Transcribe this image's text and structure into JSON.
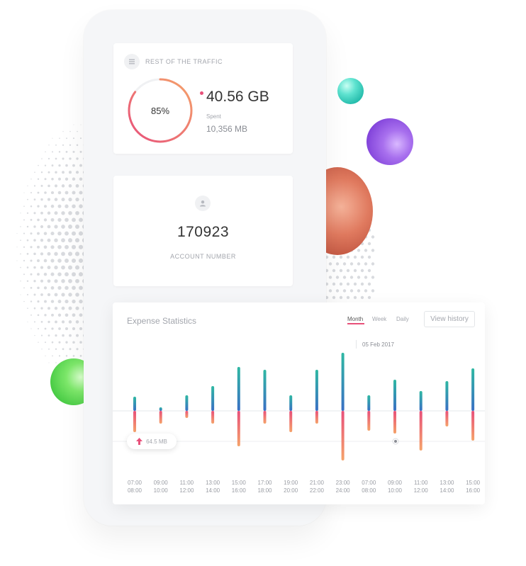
{
  "traffic": {
    "title": "REST OF THE TRAFFIC",
    "percent_label": "85%",
    "percent": 0.85,
    "value": "40.56 GB",
    "spent_label": "Spent",
    "spent_value": "10,356 MB"
  },
  "account": {
    "number": "170923",
    "label": "ACCOUNT NUMBER"
  },
  "stats": {
    "title": "Expense Statistics",
    "tabs": [
      {
        "label": "Month",
        "active": true
      },
      {
        "label": "Week",
        "active": false
      },
      {
        "label": "Daily",
        "active": false
      }
    ],
    "history_button": "View history",
    "selected_date": "05 Feb 2017",
    "tooltip": "64.5 MB"
  },
  "colors": {
    "accent": "#e8507a",
    "up_gradient": [
      "#2fb8a3",
      "#3a6fc4"
    ],
    "down_gradient": [
      "#e8507a",
      "#f5a36a"
    ]
  },
  "chart_data": {
    "type": "bar",
    "categories": [
      [
        "07:00",
        "08:00"
      ],
      [
        "09:00",
        "10:00"
      ],
      [
        "11:00",
        "12:00"
      ],
      [
        "13:00",
        "14:00"
      ],
      [
        "15:00",
        "16:00"
      ],
      [
        "17:00",
        "18:00"
      ],
      [
        "19:00",
        "20:00"
      ],
      [
        "21:00",
        "22:00"
      ],
      [
        "23:00",
        "24:00"
      ],
      [
        "07:00",
        "08:00"
      ],
      [
        "09:00",
        "10:00"
      ],
      [
        "11:00",
        "12:00"
      ],
      [
        "13:00",
        "14:00"
      ],
      [
        "15:00",
        "16:00"
      ]
    ],
    "up": [
      20,
      5,
      22,
      35,
      62,
      58,
      22,
      58,
      82,
      22,
      44,
      28,
      42,
      60
    ],
    "down": [
      -30,
      -18,
      -10,
      -18,
      -50,
      -18,
      -30,
      -18,
      -70,
      -28,
      -32,
      -56,
      -22,
      -42
    ]
  }
}
